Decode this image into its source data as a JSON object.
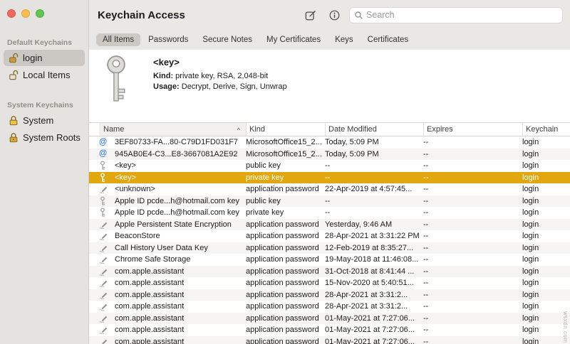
{
  "window": {
    "title": "Keychain Access"
  },
  "toolbar": {
    "search_placeholder": "Search"
  },
  "sidebar": {
    "sections": [
      {
        "header": "Default Keychains",
        "items": [
          {
            "label": "login",
            "selected": true
          },
          {
            "label": "Local Items",
            "selected": false
          }
        ]
      },
      {
        "header": "System Keychains",
        "items": [
          {
            "label": "System",
            "selected": false
          },
          {
            "label": "System Roots",
            "selected": false
          }
        ]
      }
    ]
  },
  "tabs": [
    {
      "label": "All Items",
      "selected": true
    },
    {
      "label": "Passwords",
      "selected": false
    },
    {
      "label": "Secure Notes",
      "selected": false
    },
    {
      "label": "My Certificates",
      "selected": false
    },
    {
      "label": "Keys",
      "selected": false
    },
    {
      "label": "Certificates",
      "selected": false
    }
  ],
  "detail": {
    "title": "<key>",
    "kind_label": "Kind:",
    "kind_value": "private key, RSA, 2,048-bit",
    "usage_label": "Usage:",
    "usage_value": "Decrypt, Derive, Sign, Unwrap"
  },
  "table": {
    "columns": [
      "Name",
      "Kind",
      "Date Modified",
      "Expires",
      "Keychain"
    ],
    "sort_indicator": "^",
    "rows": [
      {
        "icon": "at",
        "name": "3EF80733-FA...80-C79D1FD031F7",
        "kind": "MicrosoftOffice15_2...",
        "modified": "Today, 5:09 PM",
        "expires": "--",
        "keychain": "login",
        "selected": false
      },
      {
        "icon": "at",
        "name": "945AB0E4-C3...E8-3667081A2E92",
        "kind": "MicrosoftOffice15_2...",
        "modified": "Today, 5:09 PM",
        "expires": "--",
        "keychain": "login",
        "selected": false
      },
      {
        "icon": "key",
        "name": "<key>",
        "kind": "public key",
        "modified": "--",
        "expires": "--",
        "keychain": "login",
        "selected": false
      },
      {
        "icon": "key",
        "name": "<key>",
        "kind": "private key",
        "modified": "--",
        "expires": "--",
        "keychain": "login",
        "selected": true
      },
      {
        "icon": "pencil",
        "name": "<unknown>",
        "kind": "application password",
        "modified": "22-Apr-2019 at 4:57:45...",
        "expires": "--",
        "keychain": "login",
        "selected": false
      },
      {
        "icon": "key",
        "name": "Apple ID pcde...h@hotmail.com key",
        "kind": "public key",
        "modified": "--",
        "expires": "--",
        "keychain": "login",
        "selected": false
      },
      {
        "icon": "key",
        "name": "Apple ID pcde...h@hotmail.com key",
        "kind": "private key",
        "modified": "--",
        "expires": "--",
        "keychain": "login",
        "selected": false
      },
      {
        "icon": "pencil",
        "name": "Apple Persistent State Encryption",
        "kind": "application password",
        "modified": "Yesterday, 9:46 AM",
        "expires": "--",
        "keychain": "login",
        "selected": false
      },
      {
        "icon": "pencil",
        "name": "BeaconStore",
        "kind": "application password",
        "modified": "28-Apr-2021 at 3:31:22 PM",
        "expires": "--",
        "keychain": "login",
        "selected": false
      },
      {
        "icon": "pencil",
        "name": "Call History User Data Key",
        "kind": "application password",
        "modified": "12-Feb-2019 at 8:35:27...",
        "expires": "--",
        "keychain": "login",
        "selected": false
      },
      {
        "icon": "pencil",
        "name": "Chrome Safe Storage",
        "kind": "application password",
        "modified": "19-May-2018 at 11:46:08...",
        "expires": "--",
        "keychain": "login",
        "selected": false
      },
      {
        "icon": "pencil",
        "name": "com.apple.assistant",
        "kind": "application password",
        "modified": "31-Oct-2018 at 8:41:44 ...",
        "expires": "--",
        "keychain": "login",
        "selected": false
      },
      {
        "icon": "pencil",
        "name": "com.apple.assistant",
        "kind": "application password",
        "modified": "15-Nov-2020 at 5:40:51...",
        "expires": "--",
        "keychain": "login",
        "selected": false
      },
      {
        "icon": "pencil",
        "name": "com.apple.assistant",
        "kind": "application password",
        "modified": "28-Apr-2021 at 3:31:2...",
        "expires": "--",
        "keychain": "login",
        "selected": false
      },
      {
        "icon": "pencil",
        "name": "com.apple.assistant",
        "kind": "application password",
        "modified": "28-Apr-2021 at 3:31:2...",
        "expires": "--",
        "keychain": "login",
        "selected": false
      },
      {
        "icon": "pencil",
        "name": "com.apple.assistant",
        "kind": "application password",
        "modified": "01-May-2021 at 7:27:06...",
        "expires": "--",
        "keychain": "login",
        "selected": false
      },
      {
        "icon": "pencil",
        "name": "com.apple.assistant",
        "kind": "application password",
        "modified": "01-May-2021 at 7:27:06...",
        "expires": "--",
        "keychain": "login",
        "selected": false
      },
      {
        "icon": "pencil",
        "name": "com.apple.assistant",
        "kind": "application password",
        "modified": "01-May-2021 at 7:27:06...",
        "expires": "--",
        "keychain": "login",
        "selected": false
      }
    ]
  },
  "watermark": "wsxdn.com",
  "colors": {
    "row_selection": "#e2a60e",
    "sidebar_selection": "#cbc8c3",
    "at_icon_blue": "#3577f0",
    "chrome_gray": "#eae8e5"
  }
}
